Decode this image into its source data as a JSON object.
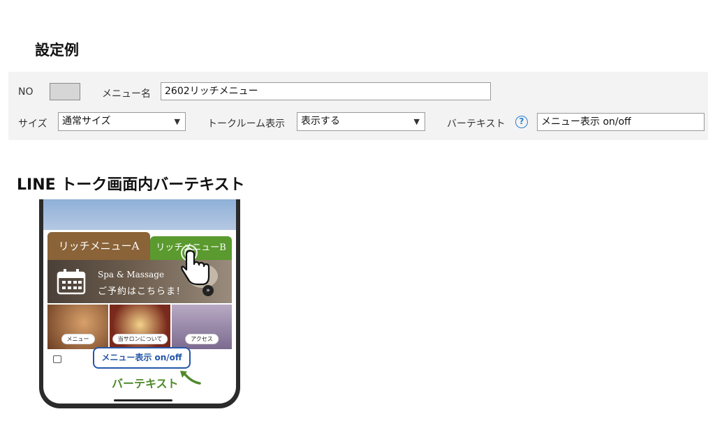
{
  "heading": "設定例",
  "settings": {
    "no_label": "NO",
    "menu_name_label": "メニュー名",
    "menu_name_value": "2602リッチメニュー",
    "size_label": "サイズ",
    "size_value": "通常サイズ",
    "talkroom_label": "トークルーム表示",
    "talkroom_value": "表示する",
    "bartext_label": "バーテキスト",
    "help_glyph": "?",
    "bartext_value": "メニュー表示 on/off"
  },
  "subheading": "LINE トーク画面内バーテキスト",
  "phone": {
    "tab_a": "リッチメニューA",
    "tab_b": "リッチメニューB",
    "banner_line1": "Spa & Massage",
    "banner_line2": "ご予約はこちらま！",
    "banner_arrow": "»",
    "tiles": [
      "メニュー",
      "当サロンについて",
      "アクセス"
    ],
    "bar_button": "メニュー表示 on/off",
    "bar_label": "バーテキスト"
  },
  "colors": {
    "accent_blue": "#2456a8",
    "green": "#5a9a2e",
    "brown": "#8a6338"
  }
}
